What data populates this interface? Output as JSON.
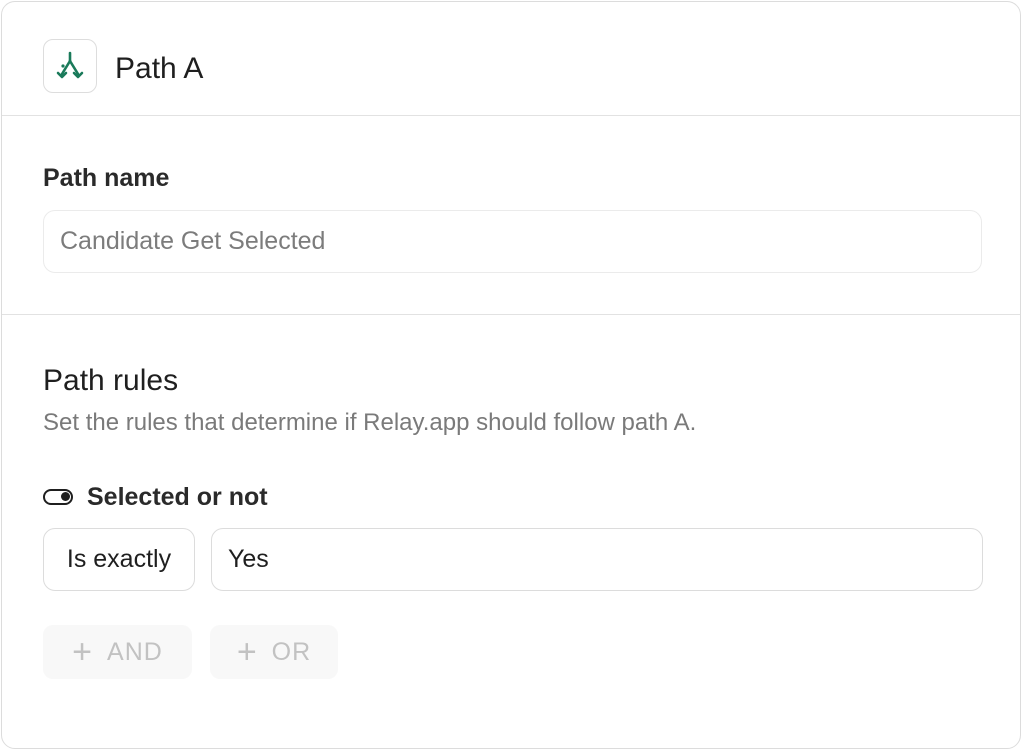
{
  "header": {
    "title": "Path A",
    "icon": "path-split-icon",
    "icon_color": "#1a7a5a"
  },
  "path_name": {
    "label": "Path name",
    "placeholder": "Candidate Get Selected",
    "value": ""
  },
  "path_rules": {
    "title": "Path rules",
    "description": "Set the rules that determine if Relay.app should follow path A.",
    "rule": {
      "field_icon": "toggle-icon",
      "field_label": "Selected or not",
      "operator": "Is exactly",
      "value": "Yes"
    },
    "and_label": "AND",
    "or_label": "OR"
  }
}
